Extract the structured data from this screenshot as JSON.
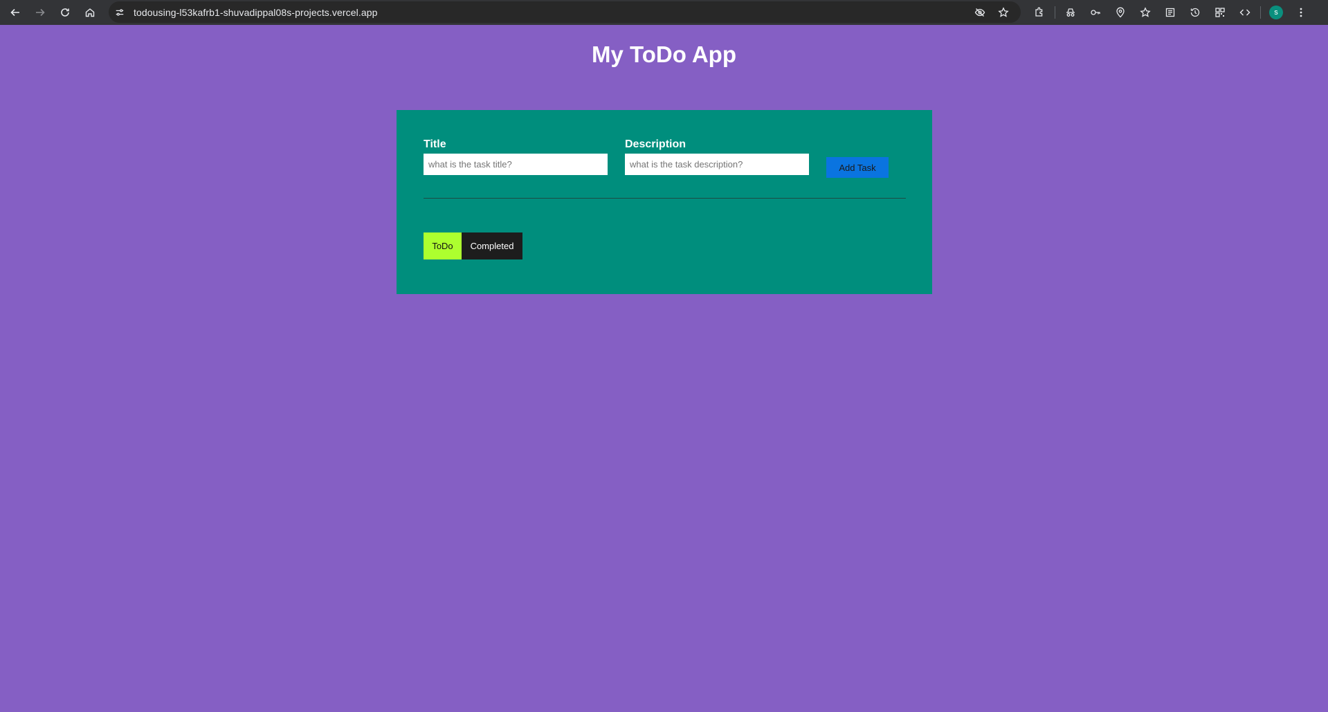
{
  "browser": {
    "url": "todousing-l53kafrb1-shuvadippal08s-projects.vercel.app",
    "profile_initial": "s",
    "icons": {
      "back": "back-arrow-icon",
      "forward": "forward-arrow-icon",
      "reload": "reload-icon",
      "home": "home-icon",
      "site_info": "site-info-icon",
      "tracking": "eye-off-icon",
      "bookmark": "star-icon",
      "extensions": "puzzle-icon"
    },
    "colors": {
      "toolbar": "#333437",
      "avatar": "#0a8f7e"
    }
  },
  "app": {
    "title": "My ToDo App",
    "background": "#855fc4",
    "card_color": "#008e7d"
  },
  "form": {
    "title_label": "Title",
    "title_placeholder": "what is the task title?",
    "title_value": "",
    "description_label": "Description",
    "description_placeholder": "what is the task description?",
    "description_value": "",
    "add_button_label": "Add Task",
    "add_button_color": "#0a74e0"
  },
  "tabs": {
    "todo_label": "ToDo",
    "completed_label": "Completed",
    "active": "ToDo",
    "todo_color": "#adff2f",
    "completed_color": "#1d1d1d"
  }
}
